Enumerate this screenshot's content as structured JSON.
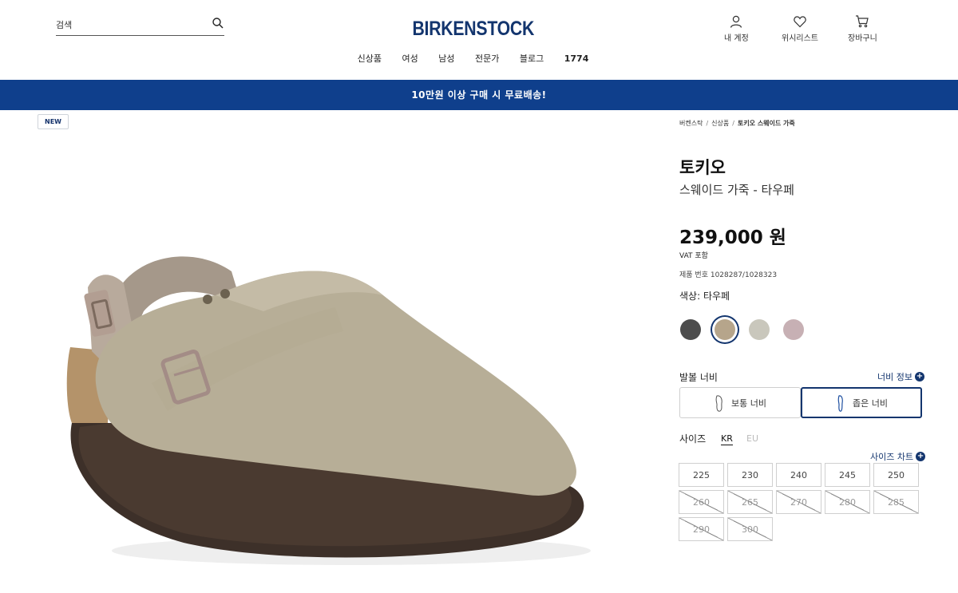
{
  "header": {
    "search_placeholder": "검색",
    "logo": "BIRKENSTOCK",
    "nav": [
      "신상품",
      "여성",
      "남성",
      "전문가",
      "블로그",
      "1774"
    ],
    "account_label": "내 계정",
    "wishlist_label": "위시리스트",
    "cart_label": "장바구니"
  },
  "banner": {
    "text": "10만원 이상 구매 시 무료배송!"
  },
  "gallery": {
    "badge": "NEW"
  },
  "breadcrumb": [
    "버켄스탁",
    "신상품",
    "토키오 스웨이드 가죽"
  ],
  "product": {
    "name": "토키오",
    "subtitle": "스웨이드 가죽 - 타우페",
    "price": "239,000 원",
    "vat": "VAT 포함",
    "sku": "제품 번호 1028287/1028323",
    "color_label": "색상: 타우페",
    "colors": [
      {
        "hex": "#4d4d4d",
        "selected": false
      },
      {
        "hex": "#b6a58b",
        "selected": true
      },
      {
        "hex": "#c9c7bc",
        "selected": false
      },
      {
        "hex": "#c7b0b4",
        "selected": false
      }
    ]
  },
  "width": {
    "label": "발볼 너비",
    "info": "너비 정보",
    "options": [
      {
        "label": "보통 너비",
        "selected": false
      },
      {
        "label": "좁은 너비",
        "selected": true
      }
    ]
  },
  "size": {
    "label": "사이즈",
    "tabs": [
      "KR",
      "EU"
    ],
    "chart": "사이즈 차트",
    "options": [
      {
        "value": "225",
        "available": true
      },
      {
        "value": "230",
        "available": true
      },
      {
        "value": "240",
        "available": true
      },
      {
        "value": "245",
        "available": true
      },
      {
        "value": "250",
        "available": true
      },
      {
        "value": "260",
        "available": false
      },
      {
        "value": "265",
        "available": false
      },
      {
        "value": "270",
        "available": false
      },
      {
        "value": "280",
        "available": false
      },
      {
        "value": "285",
        "available": false
      },
      {
        "value": "290",
        "available": false
      },
      {
        "value": "300",
        "available": false
      }
    ]
  }
}
